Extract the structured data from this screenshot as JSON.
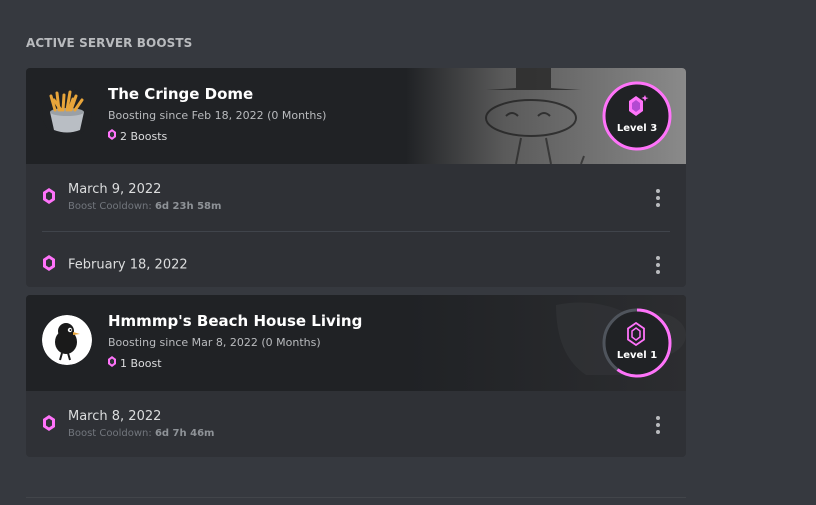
{
  "section": {
    "title": "ACTIVE SERVER BOOSTS"
  },
  "servers": [
    {
      "name": "The Cringe Dome",
      "since": "Boosting since Feb 18, 2022 (0 Months)",
      "boost_count": "2 Boosts",
      "level": "Level 3",
      "level_progress": 1.0,
      "boosts": [
        {
          "date": "March 9, 2022",
          "cooldown_label": "Boost Cooldown:",
          "cooldown_value": "6d 23h 58m"
        },
        {
          "date": "February 18, 2022"
        }
      ]
    },
    {
      "name": "Hmmmp's Beach House Living",
      "since": "Boosting since Mar 8, 2022 (0 Months)",
      "boost_count": "1 Boost",
      "level": "Level 1",
      "level_progress": 0.6,
      "boosts": [
        {
          "date": "March 8, 2022",
          "cooldown_label": "Boost Cooldown:",
          "cooldown_value": "6d 7h 46m"
        }
      ]
    }
  ],
  "colors": {
    "accent_pink": "#ff73fa",
    "background": "#36393f",
    "card": "#2f3136",
    "header": "#202225"
  }
}
